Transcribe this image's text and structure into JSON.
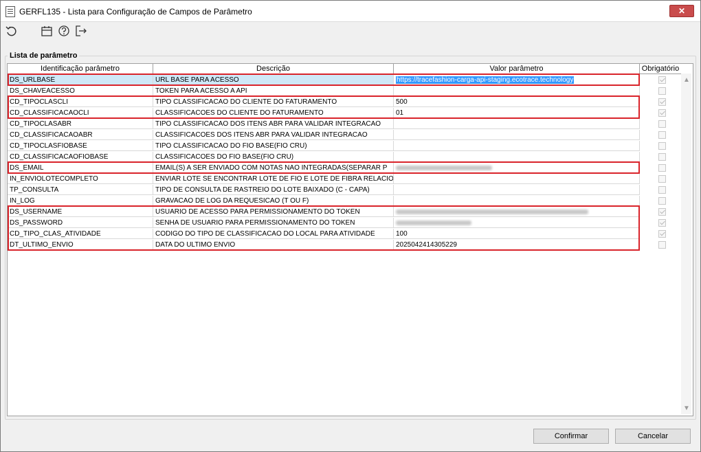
{
  "window": {
    "title": "GERFL135 - Lista para Configuração de Campos de Parâmetro",
    "close_label": "✕"
  },
  "toolbar": {
    "icons": [
      "refresh-icon",
      "calendar-icon",
      "help-icon",
      "exit-icon"
    ]
  },
  "group": {
    "label": "Lista de parâmetro"
  },
  "table": {
    "headers": [
      "Identificação parâmetro",
      "Descrição",
      "Valor parâmetro",
      "Obrigatório"
    ],
    "rows": [
      {
        "id": "DS_URLBASE",
        "desc": "URL BASE PARA ACESSO",
        "value": "https://tracefashion-carga-api-staging.ecotrace.technology",
        "required": true
      },
      {
        "id": "DS_CHAVEACESSO",
        "desc": "TOKEN PARA ACESSO A API",
        "value": "",
        "required": false
      },
      {
        "id": "CD_TIPOCLASCLI",
        "desc": "TIPO CLASSIFICACAO DO CLIENTE DO FATURAMENTO",
        "value": "500",
        "required": true
      },
      {
        "id": "CD_CLASSIFICACAOCLI",
        "desc": "CLASSIFICACOES DO CLIENTE DO FATURAMENTO",
        "value": "01",
        "required": true
      },
      {
        "id": "CD_TIPOCLASABR",
        "desc": "TIPO CLASSIFICACAO DOS ITENS ABR PARA VALIDAR INTEGRACAO",
        "value": "",
        "required": false
      },
      {
        "id": "CD_CLASSIFICACAOABR",
        "desc": "CLASSIFICACOES DOS ITENS ABR PARA VALIDAR INTEGRACAO",
        "value": "",
        "required": false
      },
      {
        "id": "CD_TIPOCLASFIOBASE",
        "desc": "TIPO CLASSIFICACAO DO FIO BASE(FIO CRU)",
        "value": "",
        "required": false
      },
      {
        "id": "CD_CLASSIFICACAOFIOBASE",
        "desc": "CLASSIFICACOES DO FIO BASE(FIO CRU)",
        "value": "",
        "required": false
      },
      {
        "id": "DS_EMAIL",
        "desc": "EMAIL(S) A SER ENVIADO COM NOTAS NAO INTEGRADAS(SEPARAR P",
        "value": "",
        "required": false
      },
      {
        "id": "IN_ENVIOLOTECOMPLETO",
        "desc": "ENVIAR LOTE SE ENCONTRAR LOTE DE FIO E LOTE DE FIBRA RELACIO",
        "value": "",
        "required": false
      },
      {
        "id": "TP_CONSULTA",
        "desc": "TIPO DE CONSULTA DE RASTREIO DO LOTE BAIXADO (C - CAPA)",
        "value": "",
        "required": false
      },
      {
        "id": "IN_LOG",
        "desc": "GRAVACAO DE LOG DA REQUESICAO (T OU F)",
        "value": "",
        "required": false
      },
      {
        "id": "DS_USERNAME",
        "desc": "USUARIO DE ACESSO PARA PERMISSIONAMENTO DO TOKEN",
        "value": "",
        "required": true
      },
      {
        "id": "DS_PASSWORD",
        "desc": "SENHA DE USUARIO PARA PERMISSIONAMENTO DO TOKEN",
        "value": "",
        "required": true
      },
      {
        "id": "CD_TIPO_CLAS_ATIVIDADE",
        "desc": "CODIGO DO TIPO DE CLASSIFICACAO DO LOCAL PARA ATIVIDADE",
        "value": "100",
        "required": true
      },
      {
        "id": "DT_ULTIMO_ENVIO",
        "desc": "DATA DO ULTIMO ENVIO",
        "value": "20250424143052​29",
        "required": false
      }
    ]
  },
  "buttons": {
    "confirm": "Confirmar",
    "cancel": "Cancelar"
  },
  "colors": {
    "highlight": "#d9232a",
    "selection": "#3399ff"
  }
}
